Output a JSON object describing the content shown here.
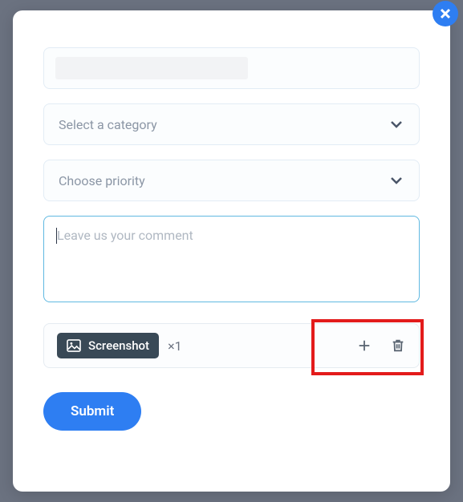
{
  "category": {
    "placeholder": "Select a category"
  },
  "priority": {
    "placeholder": "Choose priority"
  },
  "comment": {
    "placeholder": "Leave us your comment",
    "value": ""
  },
  "attachment": {
    "label": "Screenshot",
    "count_prefix": "×",
    "count": "1"
  },
  "submit": {
    "label": "Submit"
  }
}
